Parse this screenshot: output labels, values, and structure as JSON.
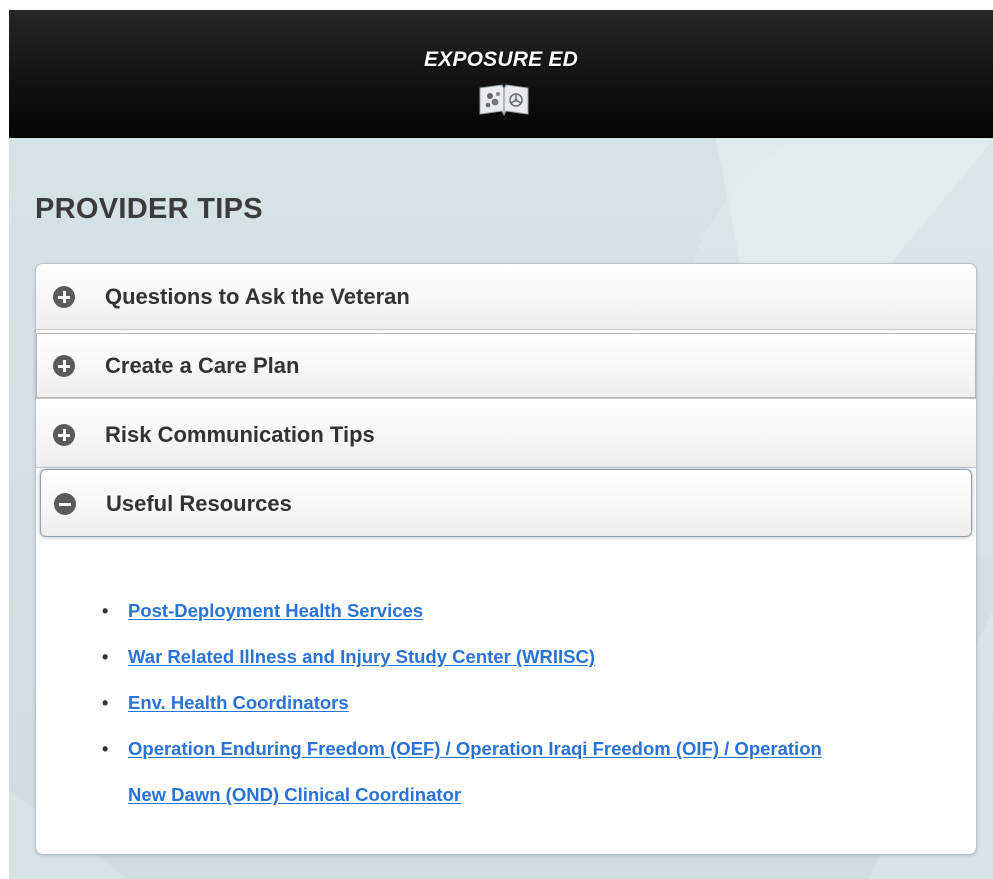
{
  "app": {
    "title": "EXPOSURE ED",
    "logo_icon": "open-book-biohazard-icon"
  },
  "page": {
    "title": "PROVIDER TIPS"
  },
  "accordion": {
    "sections": [
      {
        "label": "Questions to Ask the Veteran",
        "expanded": false,
        "icon": "plus-circle-icon"
      },
      {
        "label": "Create a Care Plan",
        "expanded": false,
        "icon": "plus-circle-icon"
      },
      {
        "label": "Risk Communication Tips",
        "expanded": false,
        "icon": "plus-circle-icon"
      },
      {
        "label": "Useful Resources",
        "expanded": true,
        "icon": "minus-circle-icon"
      }
    ],
    "resources": [
      "Post-Deployment Health Services",
      "War Related Illness and Injury Study Center (WRIISC)",
      "Env. Health Coordinators",
      "Operation Enduring Freedom (OEF) / Operation Iraqi Freedom (OIF) / Operation",
      "New Dawn (OND) Clinical Coordinator"
    ]
  },
  "colors": {
    "header_bg": "#111111",
    "page_bg": "#d4e2e7",
    "link": "#2a73d6",
    "icon": "#5b5b5b",
    "heading_text": "#3b3b3b"
  }
}
